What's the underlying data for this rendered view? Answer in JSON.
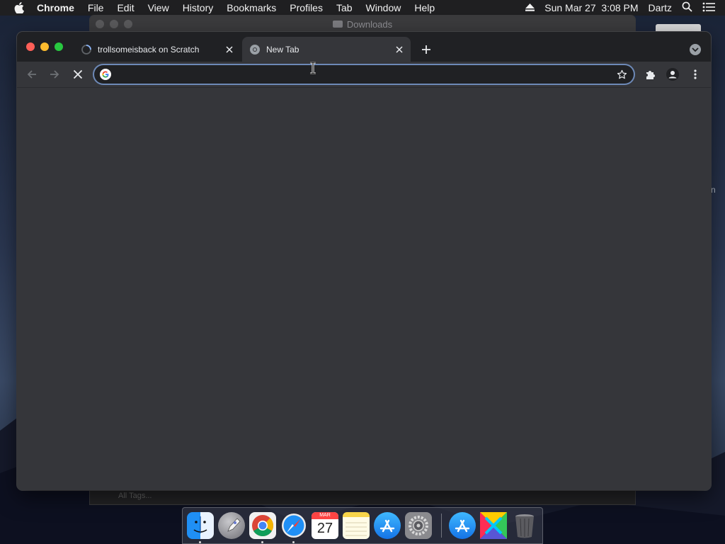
{
  "menubar": {
    "app_name": "Chrome",
    "items": [
      "File",
      "Edit",
      "View",
      "History",
      "Bookmarks",
      "Profiles",
      "Tab",
      "Window",
      "Help"
    ],
    "datetime": "Sun Mar 27  3:08 PM",
    "user": "Dartz",
    "icons": [
      "apple-icon",
      "eject-icon",
      "spotlight-search-icon",
      "control-list-icon"
    ]
  },
  "background_window": {
    "title": "Downloads",
    "footer_text": "All Tags..."
  },
  "edge_letter": "n",
  "chrome": {
    "tabs": [
      {
        "title": "trollsomeisback on Scratch",
        "active": false,
        "favicon": "loading-spinner-icon"
      },
      {
        "title": "New Tab",
        "active": true,
        "favicon": "chrome-favicon-icon"
      }
    ],
    "omnibox": {
      "value": "",
      "placeholder": ""
    },
    "toolbar_icons": [
      "back-arrow-icon",
      "forward-arrow-icon",
      "stop-loading-icon",
      "bookmark-star-icon",
      "extensions-puzzle-icon",
      "profile-avatar-icon",
      "menu-kebab-icon"
    ]
  },
  "dock": {
    "apps": [
      "Finder",
      "Launchpad",
      "Google Chrome",
      "Safari",
      "Calendar",
      "Notes",
      "App Store",
      "System Preferences",
      "App Store",
      "Pinwheel App",
      "Trash"
    ],
    "calendar": {
      "month": "MAR",
      "day": "27"
    },
    "running": [
      "Finder",
      "Google Chrome",
      "Safari"
    ]
  },
  "colors": {
    "accent_focus": "#6d89b7",
    "tabstrip_bg": "#202124",
    "toolbar_bg": "#35363a"
  }
}
